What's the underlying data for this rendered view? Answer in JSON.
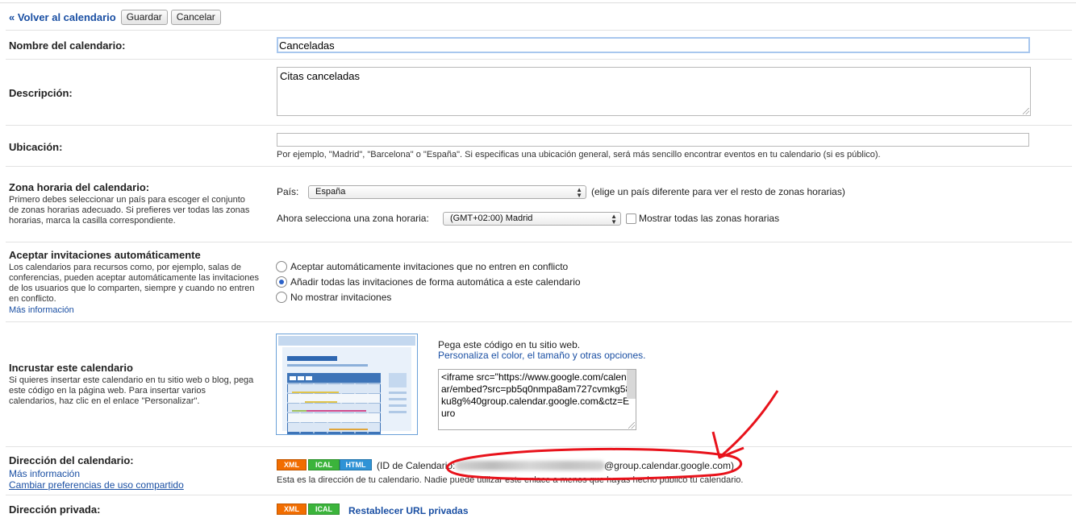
{
  "toolbar": {
    "back_label": "« Volver al calendario",
    "save_label": "Guardar",
    "cancel_label": "Cancelar"
  },
  "name": {
    "label": "Nombre del calendario:",
    "value": "Canceladas"
  },
  "description": {
    "label": "Descripción:",
    "value": "Citas canceladas"
  },
  "location": {
    "label": "Ubicación:",
    "value": "",
    "hint": "Por ejemplo, \"Madrid\", \"Barcelona\" o \"España\". Si especificas una ubicación general, será más sencillo encontrar eventos en tu calendario (si es público)."
  },
  "timezone": {
    "label": "Zona horaria del calendario:",
    "desc": "Primero debes seleccionar un país para escoger el conjunto de zonas horarias adecuado. Si prefieres ver todas las zonas horarias, marca la casilla correspondiente.",
    "country_label": "País:",
    "country_value": "España",
    "country_hint": "(elige un país diferente para ver el resto de zonas horarias)",
    "zone_label": "Ahora selecciona una zona horaria:",
    "zone_value": "(GMT+02:00) Madrid",
    "show_all_label": "Mostrar todas las zonas horarias",
    "show_all_checked": false
  },
  "invitations": {
    "label": "Aceptar invitaciones automáticamente",
    "desc": "Los calendarios para recursos como, por ejemplo, salas de conferencias, pueden aceptar automáticamente las invitaciones de los usuarios que lo comparten, siempre y cuando no entren en conflicto.",
    "more_link": "Más información",
    "options": [
      "Aceptar automáticamente invitaciones que no entren en conflicto",
      "Añadir todas las invitaciones de forma automática a este calendario",
      "No mostrar invitaciones"
    ],
    "selected_index": 1
  },
  "embed": {
    "label": "Incrustar este calendario",
    "desc": "Si quieres insertar este calendario en tu sitio web o blog, pega este código en la página web. Para insertar varios calendarios, haz clic en el enlace \"Personalizar\".",
    "paste_text": "Pega este código en tu sitio web.",
    "customize_link": "Personaliza el color, el tamaño y otras opciones.",
    "code": "<iframe src=\"https://www.google.com/calendar/embed?src=pb5q0nmpa8am727cvmkg58ku8g%40group.calendar.google.com&ctz=Euro"
  },
  "address": {
    "label": "Dirección del calendario:",
    "more_link": "Más información",
    "share_link": "Cambiar preferencias de uso compartido",
    "badges": [
      "XML",
      "ICAL",
      "HTML"
    ],
    "id_prefix": "(ID de Calendario:",
    "id_suffix": "@group.calendar.google.com)",
    "note": "Esta es la dirección de tu calendario. Nadie puede utilizar este enlace a menos que hayas hecho público tu calendario."
  },
  "private": {
    "label": "Dirección privada:",
    "badges": [
      "XML",
      "ICAL"
    ],
    "reset_link": "Restablecer URL privadas"
  },
  "colors": {
    "link": "#1a4fa3",
    "annotation": "#e8121b",
    "xml": "#f26d00",
    "ical": "#3bb43b",
    "html": "#2f93d6"
  }
}
